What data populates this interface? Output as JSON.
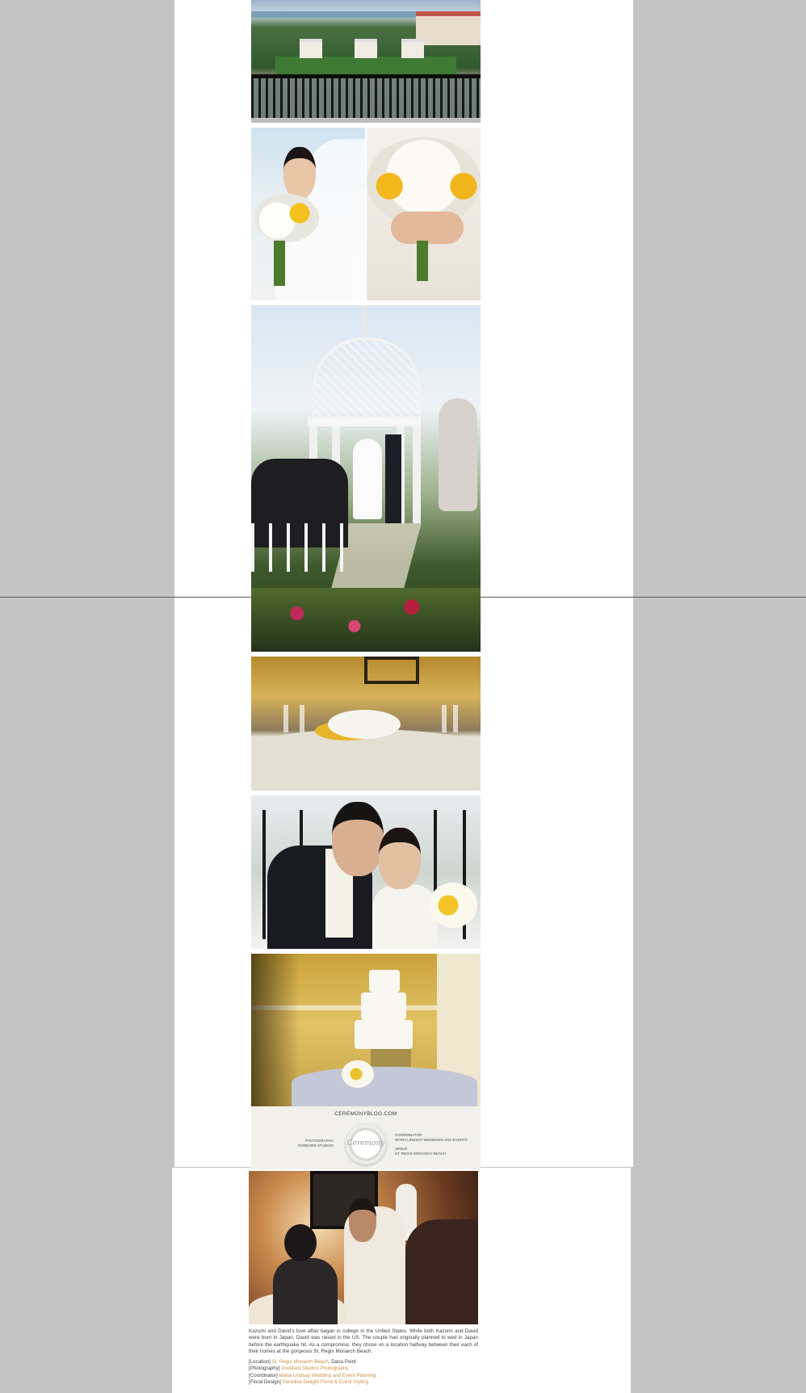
{
  "credits": {
    "site": "CEREMONYBLOG.COM",
    "logo_text": "Ceremony",
    "left": [
      {
        "role": "PHOTOGRAPHY",
        "value": "GODDARD STUDIOS"
      }
    ],
    "right": [
      {
        "role": "COORDINATOR",
        "value": "MARIA LINDSAY WEDDINGS AND EVENTS"
      },
      {
        "role": "VENUE",
        "value": "ST. REGIS MONARCH BEACH"
      }
    ]
  },
  "article": {
    "text": "Kazumi and David's love affair began in college in the United States. While both Kazumi and David were born in Japan, David was raised in the US. The couple had originally planned to wed in Japan before the earthquake hit. As a compromise, they chose on a location halfway between their each of their homes at the gorgeous St. Regis Monarch Beach."
  },
  "vendors": [
    {
      "tag": "[Location]",
      "link": "St. Regis Monarch Beach",
      "suffix": ", Dana Point"
    },
    {
      "tag": "[Photography]",
      "link": "Goddard Studios Photography",
      "suffix": ""
    },
    {
      "tag": "[Coordinator]",
      "link": "Maria Lindsay Wedding and Event Planning",
      "suffix": ""
    },
    {
      "tag": "[Floral Design]",
      "link": "Paradise Delight Floral & Event Styling",
      "suffix": ""
    }
  ],
  "colors": {
    "background": "#c4c4c4",
    "page": "#ffffff",
    "link": "#c9964a",
    "panel": "#f1f0eb"
  }
}
